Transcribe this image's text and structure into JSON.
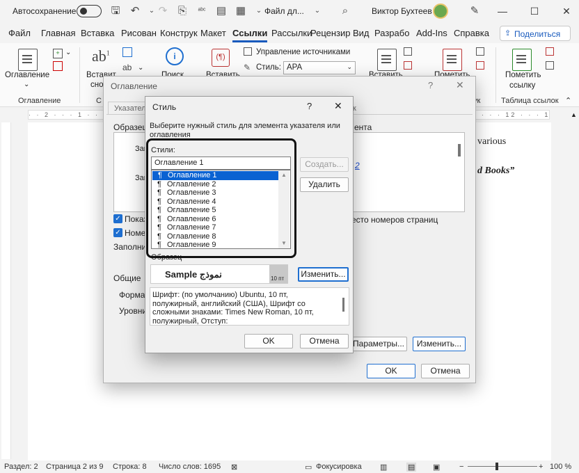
{
  "titlebar": {
    "autosave_label": "Автосохранение",
    "doc_title": "Файл дл...",
    "user_name": "Виктор Бухтеев"
  },
  "tabs": [
    "Файл",
    "Главная",
    "Вставка",
    "Рисован",
    "Конструк",
    "Макет",
    "Ссылки",
    "Рассылки",
    "Рецензир",
    "Вид",
    "Разрабо",
    "Add-Ins",
    "Справка"
  ],
  "share_label": "Поделиться",
  "ribbon": {
    "toc_label": "Оглавление",
    "toc_group": "Оглавление",
    "insert_label_1": "Вставит",
    "insert_label_2": "сно",
    "search_label": "Поиск",
    "insert2_label": "Вставить",
    "manage_sources": "Управление источниками",
    "style_label": "Стиль:",
    "style_value": "APA",
    "insert3_label": "Вставить",
    "mark_label": "Пометить",
    "mark_entry_1": "Пометить",
    "mark_entry_2": "ссылку",
    "toa_group": "Таблица ссылок",
    "group_c": "С",
    "group_k": "ук"
  },
  "document": {
    "line1": "various",
    "line2": "d Books”"
  },
  "status": {
    "section": "Раздел: 2",
    "page": "Страница 2 из 9",
    "line": "Строка: 8",
    "words": "Число слов: 1695",
    "focus": "Фокусировка",
    "zoom": "100 %"
  },
  "outer_dialog": {
    "title": "Оглавление",
    "help": "?",
    "close": "✕",
    "tab_index": "Указател",
    "tab_k": "к",
    "preview_label": "Образец",
    "preview_right": "ента",
    "zap1": "Запо",
    "zap2": "Зап",
    "link_frag": "2",
    "show_numbers": "Показ",
    "right_align": "Номер",
    "instead_numbers": "есто номеров страниц",
    "fill_label": "Заполни",
    "general_label": "Общие",
    "formats_label": "Формат",
    "levels_label": "Уровни",
    "params_button": "Параметры...",
    "modify_button": "Изменить...",
    "ok": "OK",
    "cancel": "Отмена"
  },
  "style_dialog": {
    "title": "Стиль",
    "help": "?",
    "close": "✕",
    "prompt": "Выберите нужный стиль для элемента указателя или оглавления",
    "styles_label": "Стили:",
    "current_style": "Оглавление 1",
    "create_button": "Создать...",
    "delete_button": "Удалить",
    "styles": [
      "Оглавление 1",
      "Оглавление 2",
      "Оглавление 3",
      "Оглавление 4",
      "Оглавление 5",
      "Оглавление 6",
      "Оглавление 7",
      "Оглавление 8",
      "Оглавление 9"
    ],
    "selected_index": 0,
    "sample_label": "Образец",
    "sample_text": "Sample نموذج",
    "sample_size": "10 пт",
    "modify_button": "Изменить...",
    "description": "Шрифт: (по умолчанию) Ubuntu, 10 пт, полужирный, английский (США), Шрифт со сложными знаками: Times New Roman, 10 пт, полужирный, Отступ:",
    "ok": "OK",
    "cancel": "Отмена"
  }
}
